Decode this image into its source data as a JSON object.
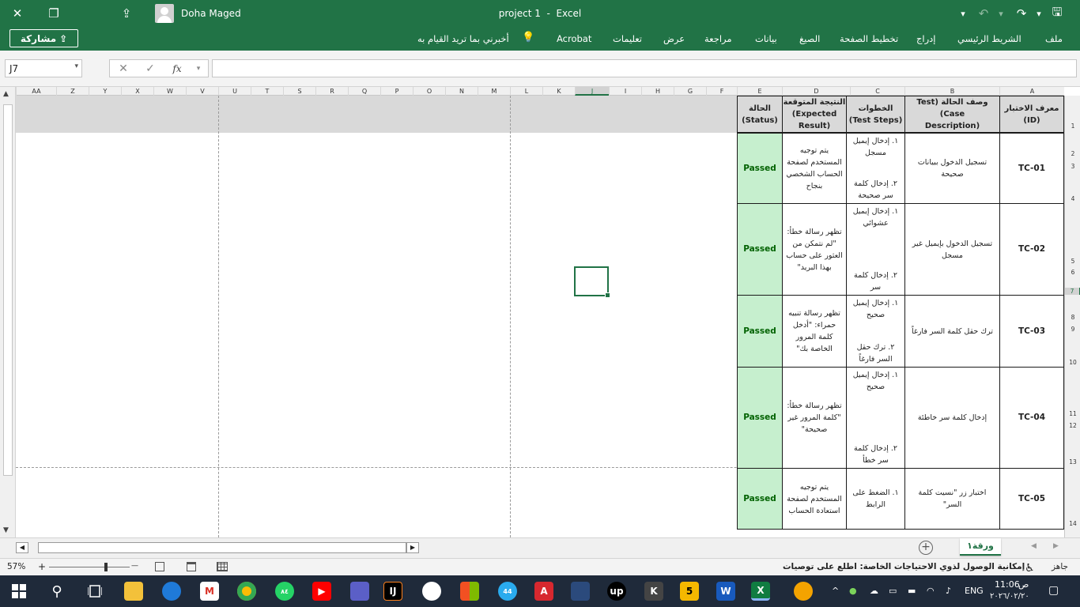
{
  "titlebar": {
    "user_name": "Doha Maged",
    "doc_name": "project 1",
    "separator": "  -  ",
    "app_name": "Excel",
    "close_glyph": "✕",
    "restore_glyph": "❐",
    "share_glyph": "⇪",
    "dd_glyph": "▾",
    "undo_glyph": "↶",
    "redo_glyph": "↷",
    "save_glyph": "🖫"
  },
  "ribbon": {
    "share_label": "مشاركة",
    "tabs": [
      "ملف",
      "الشريط الرئيسي",
      "إدراج",
      "تخطيط الصفحة",
      "الصيغ",
      "بيانات",
      "مراجعة",
      "عرض",
      "تعليمات",
      "Acrobat"
    ],
    "tell_me": "أخبرني بما تريد القيام به"
  },
  "formula_bar": {
    "name_box": "J7",
    "name_box_dd": "▾",
    "cancel_glyph": "✕",
    "enter_glyph": "✓",
    "fx_glyph": "fx",
    "fx_dd": "▾",
    "formula": ""
  },
  "sheet": {
    "columns": [
      "AA",
      "Z",
      "Y",
      "X",
      "W",
      "V",
      "U",
      "T",
      "S",
      "R",
      "Q",
      "P",
      "O",
      "N",
      "M",
      "L",
      "K",
      "J",
      "I",
      "H",
      "G",
      "F",
      "E",
      "D",
      "C",
      "B",
      "A"
    ],
    "rows": [
      "1",
      "2",
      "3",
      "4",
      "5",
      "6",
      "7",
      "8",
      "9",
      "10",
      "11",
      "12",
      "13",
      "14"
    ],
    "up_arrow": "▲",
    "down_arrow": "▼"
  },
  "table": {
    "headers": {
      "id": [
        "معرف الاختبار (ID)"
      ],
      "description": [
        "وصف الحالة (Test Case)",
        "(Description"
      ],
      "steps": [
        "الخطوات",
        "(Test Steps)"
      ],
      "expected": [
        "النتيجة المتوقعة",
        "Expected)",
        "(Result"
      ],
      "status": [
        "الحالة",
        "(Status)"
      ]
    },
    "rows": [
      {
        "id": "TC-01",
        "description": "تسجيل الدخول ببيانات صحيحة",
        "steps": [
          "١. إدخال إيميل مسجل",
          "٢. إدخال كلمة سر صحيحة"
        ],
        "expected": "يتم توجيه المستخدم لصفحة الحساب الشخصي بنجاح",
        "status": "Passed"
      },
      {
        "id": "TC-02",
        "description": "تسجيل الدخول بإيميل غير مسجل",
        "steps": [
          "١. إدخال إيميل عشوائي",
          "٢. إدخال كلمة سر"
        ],
        "expected": "تظهر رسالة خطأ: \"لم نتمكن من العثور على حساب بهذا البريد\"",
        "status": "Passed"
      },
      {
        "id": "TC-03",
        "description": "ترك حقل كلمة السر فارغاً",
        "steps": [
          "١. إدخال إيميل صحيح",
          "٢. ترك حقل السر فارغاً"
        ],
        "expected": "تظهر رسالة تنبيه حمراء: \"أدخل كلمة المرور الخاصة بك\"",
        "status": "Passed"
      },
      {
        "id": "TC-04",
        "description": "إدخال كلمة سر خاطئة",
        "steps": [
          "١. إدخال إيميل صحيح",
          "٢. إدخال كلمة سر خطأ"
        ],
        "expected": "تظهر رسالة خطأ: \"كلمة المرور غير صحيحة\"",
        "status": "Passed"
      },
      {
        "id": "TC-05",
        "description": "اختبار زر \"نسيت كلمة السر\"",
        "steps": [
          "١. الضغط على الرابط"
        ],
        "expected": "يتم توجيه المستخدم لصفحة استعادة الحساب",
        "status": "Passed"
      }
    ]
  },
  "sheet_tabs": {
    "active": "ورقة١",
    "add_glyph": "+",
    "left_glyph": "◀",
    "right_glyph": "▶",
    "nav_prev": "◀",
    "nav_next": "▶"
  },
  "statusbar": {
    "ready": "جاهز",
    "accessibility": "إمكانية الوصول لذوي الاحتياجات الخاصة: اطلع على توصيات",
    "zoom": "57%",
    "zoom_minus": "—",
    "zoom_plus": "+"
  },
  "taskbar": {
    "lang": "ENG",
    "ampm": "ص",
    "time": "11:06",
    "date": "٢٠٢٦/٠٢/٢٠",
    "whatsapp_badge": "٨٤",
    "telegram_badge": "44",
    "tray_up": "^"
  },
  "colors": {
    "excel_green": "#217346",
    "passed_fill": "#c6efce",
    "passed_text": "#006100",
    "header_fill": "#d9d9d9"
  }
}
